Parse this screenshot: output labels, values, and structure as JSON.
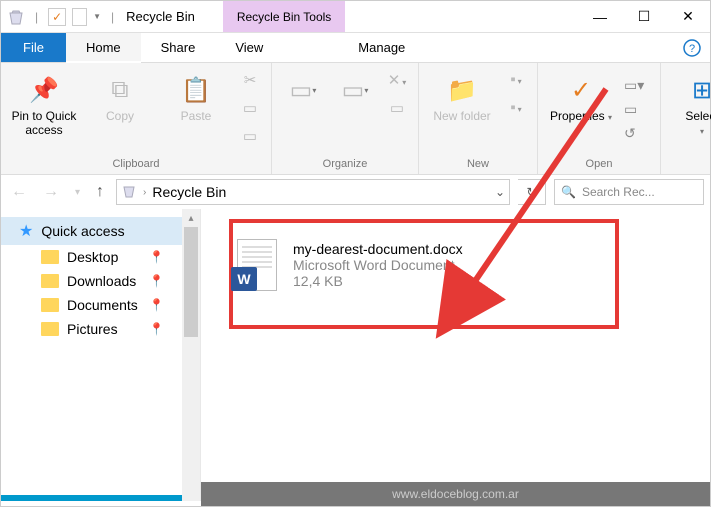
{
  "title_bar": {
    "app_title": "Recycle Bin",
    "tools_tab": "Recycle Bin Tools"
  },
  "tabs": {
    "file": "File",
    "home": "Home",
    "share": "Share",
    "view": "View",
    "manage": "Manage"
  },
  "ribbon": {
    "pin": "Pin to Quick access",
    "copy": "Copy",
    "paste": "Paste",
    "clipboard": "Clipboard",
    "organize": "Organize",
    "newfolder": "New folder",
    "new": "New",
    "properties": "Properties",
    "open": "Open",
    "select": "Select"
  },
  "addr": {
    "location": "Recycle Bin",
    "search_placeholder": "Search Rec..."
  },
  "sidebar": {
    "quick": "Quick access",
    "desktop": "Desktop",
    "downloads": "Downloads",
    "documents": "Documents",
    "pictures": "Pictures"
  },
  "file_item": {
    "name": "my-dearest-document.docx",
    "type": "Microsoft Word Document",
    "size": "12,4 KB",
    "badge": "W"
  },
  "footer": {
    "watermark": "www.eldoceblog.com.ar"
  }
}
